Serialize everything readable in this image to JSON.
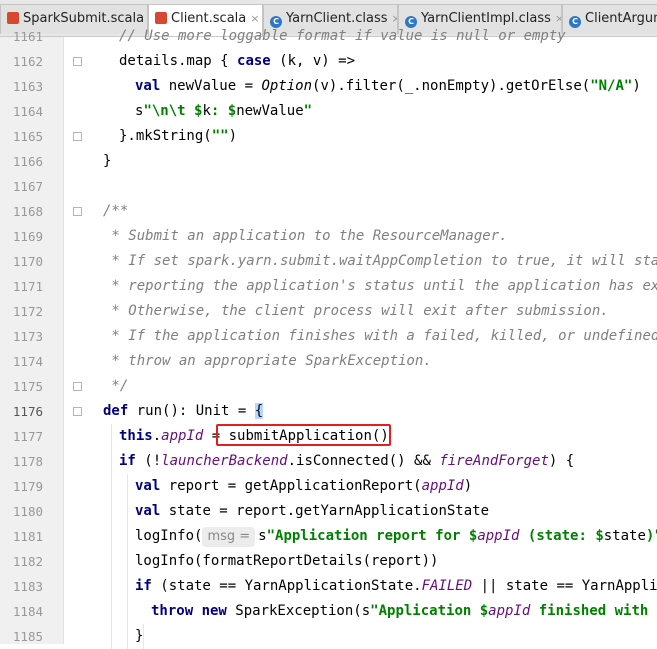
{
  "tabs": [
    {
      "label": "SparkSubmit.scala",
      "icon": "scala-file-icon",
      "active": false
    },
    {
      "label": "Client.scala",
      "icon": "scala-file-icon",
      "active": true
    },
    {
      "label": "YarnClient.class",
      "icon": "class-file-icon",
      "active": false
    },
    {
      "label": "YarnClientImpl.class",
      "icon": "class-file-icon",
      "active": false
    },
    {
      "label": "ClientArgum",
      "icon": "class-file-icon",
      "active": false
    }
  ],
  "lines": [
    {
      "num": "1161",
      "segments": [
        {
          "c": "cmt",
          "t": "// Use more loggable format if value is null or empty"
        }
      ]
    },
    {
      "num": "1162",
      "segments": [
        {
          "c": "",
          "t": "details.map { "
        },
        {
          "c": "kw",
          "t": "case"
        },
        {
          "c": "",
          "t": " (k, v) =>"
        }
      ]
    },
    {
      "num": "1163",
      "segments": [
        {
          "c": "kw",
          "t": "val"
        },
        {
          "c": "",
          "t": " newValue = "
        },
        {
          "c": "itl",
          "t": "Option"
        },
        {
          "c": "",
          "t": "(v).filter(_.nonEmpty).getOrElse("
        },
        {
          "c": "str",
          "t": "\"N/A\""
        },
        {
          "c": "",
          "t": ")"
        }
      ]
    },
    {
      "num": "1164",
      "segments": [
        {
          "c": "",
          "t": "s"
        },
        {
          "c": "str",
          "t": "\"\\n\\t $"
        },
        {
          "c": "",
          "t": "k"
        },
        {
          "c": "str",
          "t": ": $"
        },
        {
          "c": "",
          "t": "newValue"
        },
        {
          "c": "str",
          "t": "\""
        }
      ]
    },
    {
      "num": "1165",
      "segments": [
        {
          "c": "",
          "t": "}.mkString("
        },
        {
          "c": "str",
          "t": "\"\""
        },
        {
          "c": "",
          "t": ")"
        }
      ]
    },
    {
      "num": "1166",
      "segments": [
        {
          "c": "",
          "t": "}"
        }
      ]
    },
    {
      "num": "1167",
      "segments": []
    },
    {
      "num": "1168",
      "segments": [
        {
          "c": "cmt",
          "t": "/**"
        }
      ]
    },
    {
      "num": "1169",
      "segments": [
        {
          "c": "cmt",
          "t": " * Submit an application to the ResourceManager."
        }
      ]
    },
    {
      "num": "1170",
      "segments": [
        {
          "c": "cmt",
          "t": " * If set spark.yarn.submit.waitAppCompletion to true, it will stay a"
        }
      ]
    },
    {
      "num": "1171",
      "segments": [
        {
          "c": "cmt",
          "t": " * reporting the application's status until the application has exite"
        }
      ]
    },
    {
      "num": "1172",
      "segments": [
        {
          "c": "cmt",
          "t": " * Otherwise, the client process will exit after submission."
        }
      ]
    },
    {
      "num": "1173",
      "segments": [
        {
          "c": "cmt",
          "t": " * If the application finishes with a failed, killed, or undefined st"
        }
      ]
    },
    {
      "num": "1174",
      "segments": [
        {
          "c": "cmt",
          "t": " * throw an appropriate SparkException."
        }
      ]
    },
    {
      "num": "1175",
      "segments": [
        {
          "c": "cmt",
          "t": " */"
        }
      ]
    },
    {
      "num": "1176",
      "segments": [
        {
          "c": "kw",
          "t": "def"
        },
        {
          "c": "",
          "t": " run(): Unit = "
        },
        {
          "c": "caret-hl",
          "t": "{"
        }
      ]
    },
    {
      "num": "1177",
      "segments": [
        {
          "c": "kw",
          "t": "this"
        },
        {
          "c": "",
          "t": "."
        },
        {
          "c": "fld",
          "t": "appId"
        },
        {
          "c": "",
          "t": " = submitApplication()"
        }
      ]
    },
    {
      "num": "1178",
      "segments": [
        {
          "c": "kw",
          "t": "if"
        },
        {
          "c": "",
          "t": " (!"
        },
        {
          "c": "fld",
          "t": "launcherBackend"
        },
        {
          "c": "",
          "t": ".isConnected() && "
        },
        {
          "c": "fld",
          "t": "fireAndForget"
        },
        {
          "c": "",
          "t": ") {"
        }
      ]
    },
    {
      "num": "1179",
      "segments": [
        {
          "c": "kw",
          "t": "val"
        },
        {
          "c": "",
          "t": " report = getApplicationReport("
        },
        {
          "c": "fld",
          "t": "appId"
        },
        {
          "c": "",
          "t": ")"
        }
      ]
    },
    {
      "num": "1180",
      "segments": [
        {
          "c": "kw",
          "t": "val"
        },
        {
          "c": "",
          "t": " state = report.getYarnApplicationState"
        }
      ]
    },
    {
      "num": "1181",
      "segments": [
        {
          "c": "",
          "t": "logInfo("
        },
        {
          "c": "hint",
          "t": "msg ="
        },
        {
          "c": "",
          "t": "s"
        },
        {
          "c": "str",
          "t": "\"Application report for $"
        },
        {
          "c": "fld",
          "t": "appId"
        },
        {
          "c": "str",
          "t": " (state: $"
        },
        {
          "c": "",
          "t": "state"
        },
        {
          "c": "str",
          "t": ")\""
        },
        {
          "c": "",
          "t": ")"
        }
      ]
    },
    {
      "num": "1182",
      "segments": [
        {
          "c": "",
          "t": "logInfo(formatReportDetails(report))"
        }
      ]
    },
    {
      "num": "1183",
      "segments": [
        {
          "c": "kw",
          "t": "if"
        },
        {
          "c": "",
          "t": " (state == YarnApplicationState."
        },
        {
          "c": "fld",
          "t": "FAILED"
        },
        {
          "c": "",
          "t": " || state == YarnApplicat"
        }
      ]
    },
    {
      "num": "1184",
      "segments": [
        {
          "c": "kw",
          "t": "throw new"
        },
        {
          "c": "",
          "t": " SparkException(s"
        },
        {
          "c": "str",
          "t": "\"Application $"
        },
        {
          "c": "fld",
          "t": "appId"
        },
        {
          "c": "str",
          "t": " finished with sta"
        }
      ]
    },
    {
      "num": "1185",
      "segments": [
        {
          "c": "",
          "t": "}"
        }
      ]
    }
  ]
}
